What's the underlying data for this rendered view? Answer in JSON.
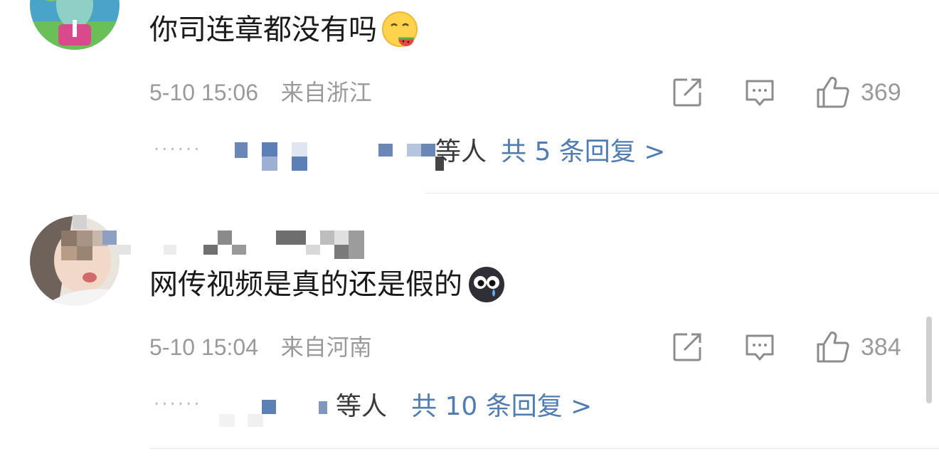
{
  "comments": [
    {
      "text": "你司连章都没有吗",
      "emoji": "melon-eating-emoji",
      "date": "5-10 15:06",
      "location": "来自浙江",
      "likes": "369",
      "reply_suffix": "等人",
      "reply_link": "共 5 条回复 >"
    },
    {
      "text": "网传视频是真的还是假的",
      "emoji": "crying-face-emoji",
      "date": "5-10 15:04",
      "location": "来自河南",
      "likes": "384",
      "reply_suffix": "等人",
      "reply_link": "共 10 条回复 >"
    }
  ],
  "reply_dots": "......",
  "colors": {
    "link": "#4f7cb3",
    "meta": "#9a9a9a",
    "text": "#1a1a1a"
  },
  "icons": [
    "repost-icon",
    "comment-icon",
    "like-icon"
  ]
}
